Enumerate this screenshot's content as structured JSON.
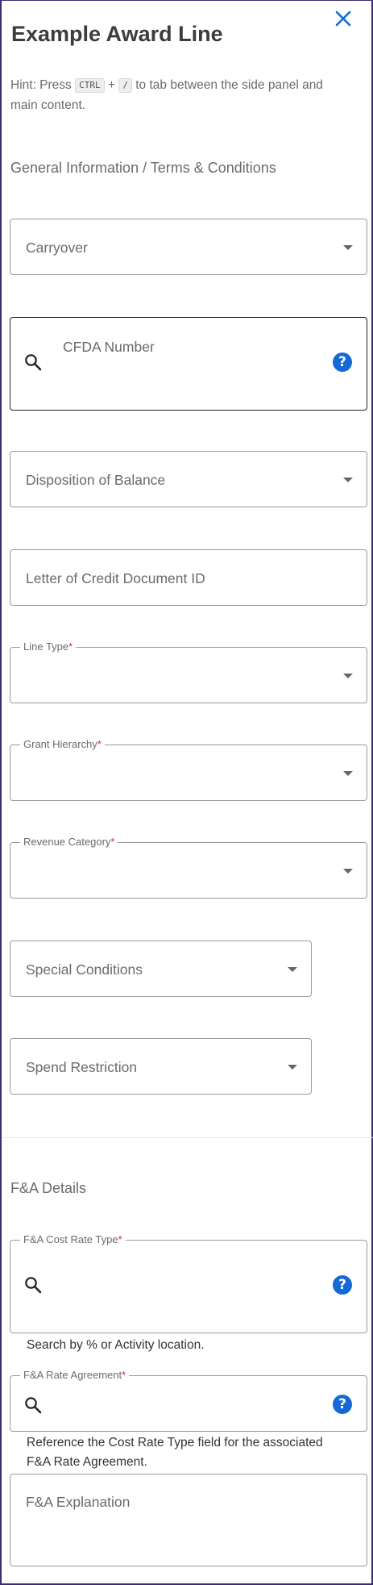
{
  "header": {
    "title": "Example Award Line"
  },
  "hint": {
    "prefix": "Hint: Press",
    "key1": "CTRL",
    "plus": "+",
    "key2": "/",
    "suffix": "to tab between the side panel and main content."
  },
  "sections": {
    "general": "General Information / Terms & Conditions",
    "fa": "F&A Details"
  },
  "fields": {
    "carryover": "Carryover",
    "cfda": "CFDA Number",
    "disposition": "Disposition of Balance",
    "letter_of_credit": "Letter of Credit Document ID",
    "line_type": "Line Type",
    "grant_hierarchy": "Grant Hierarchy",
    "revenue_category": "Revenue Category",
    "special_conditions": "Special Conditions",
    "spend_restriction": "Spend Restriction",
    "fa_cost_rate_type": "F&A Cost Rate Type",
    "fa_cost_rate_type_helper": "Search by % or Activity location.",
    "fa_rate_agreement": "F&A Rate Agreement",
    "fa_rate_agreement_helper": "Reference the Cost Rate Type field for the associated F&A Rate Agreement.",
    "fa_explanation": "F&A Explanation"
  },
  "required_mark": "*",
  "icons": {
    "help_glyph": "?"
  },
  "colors": {
    "accent": "#1469d6",
    "border": "#3d2b73",
    "required": "#d32f2f"
  }
}
